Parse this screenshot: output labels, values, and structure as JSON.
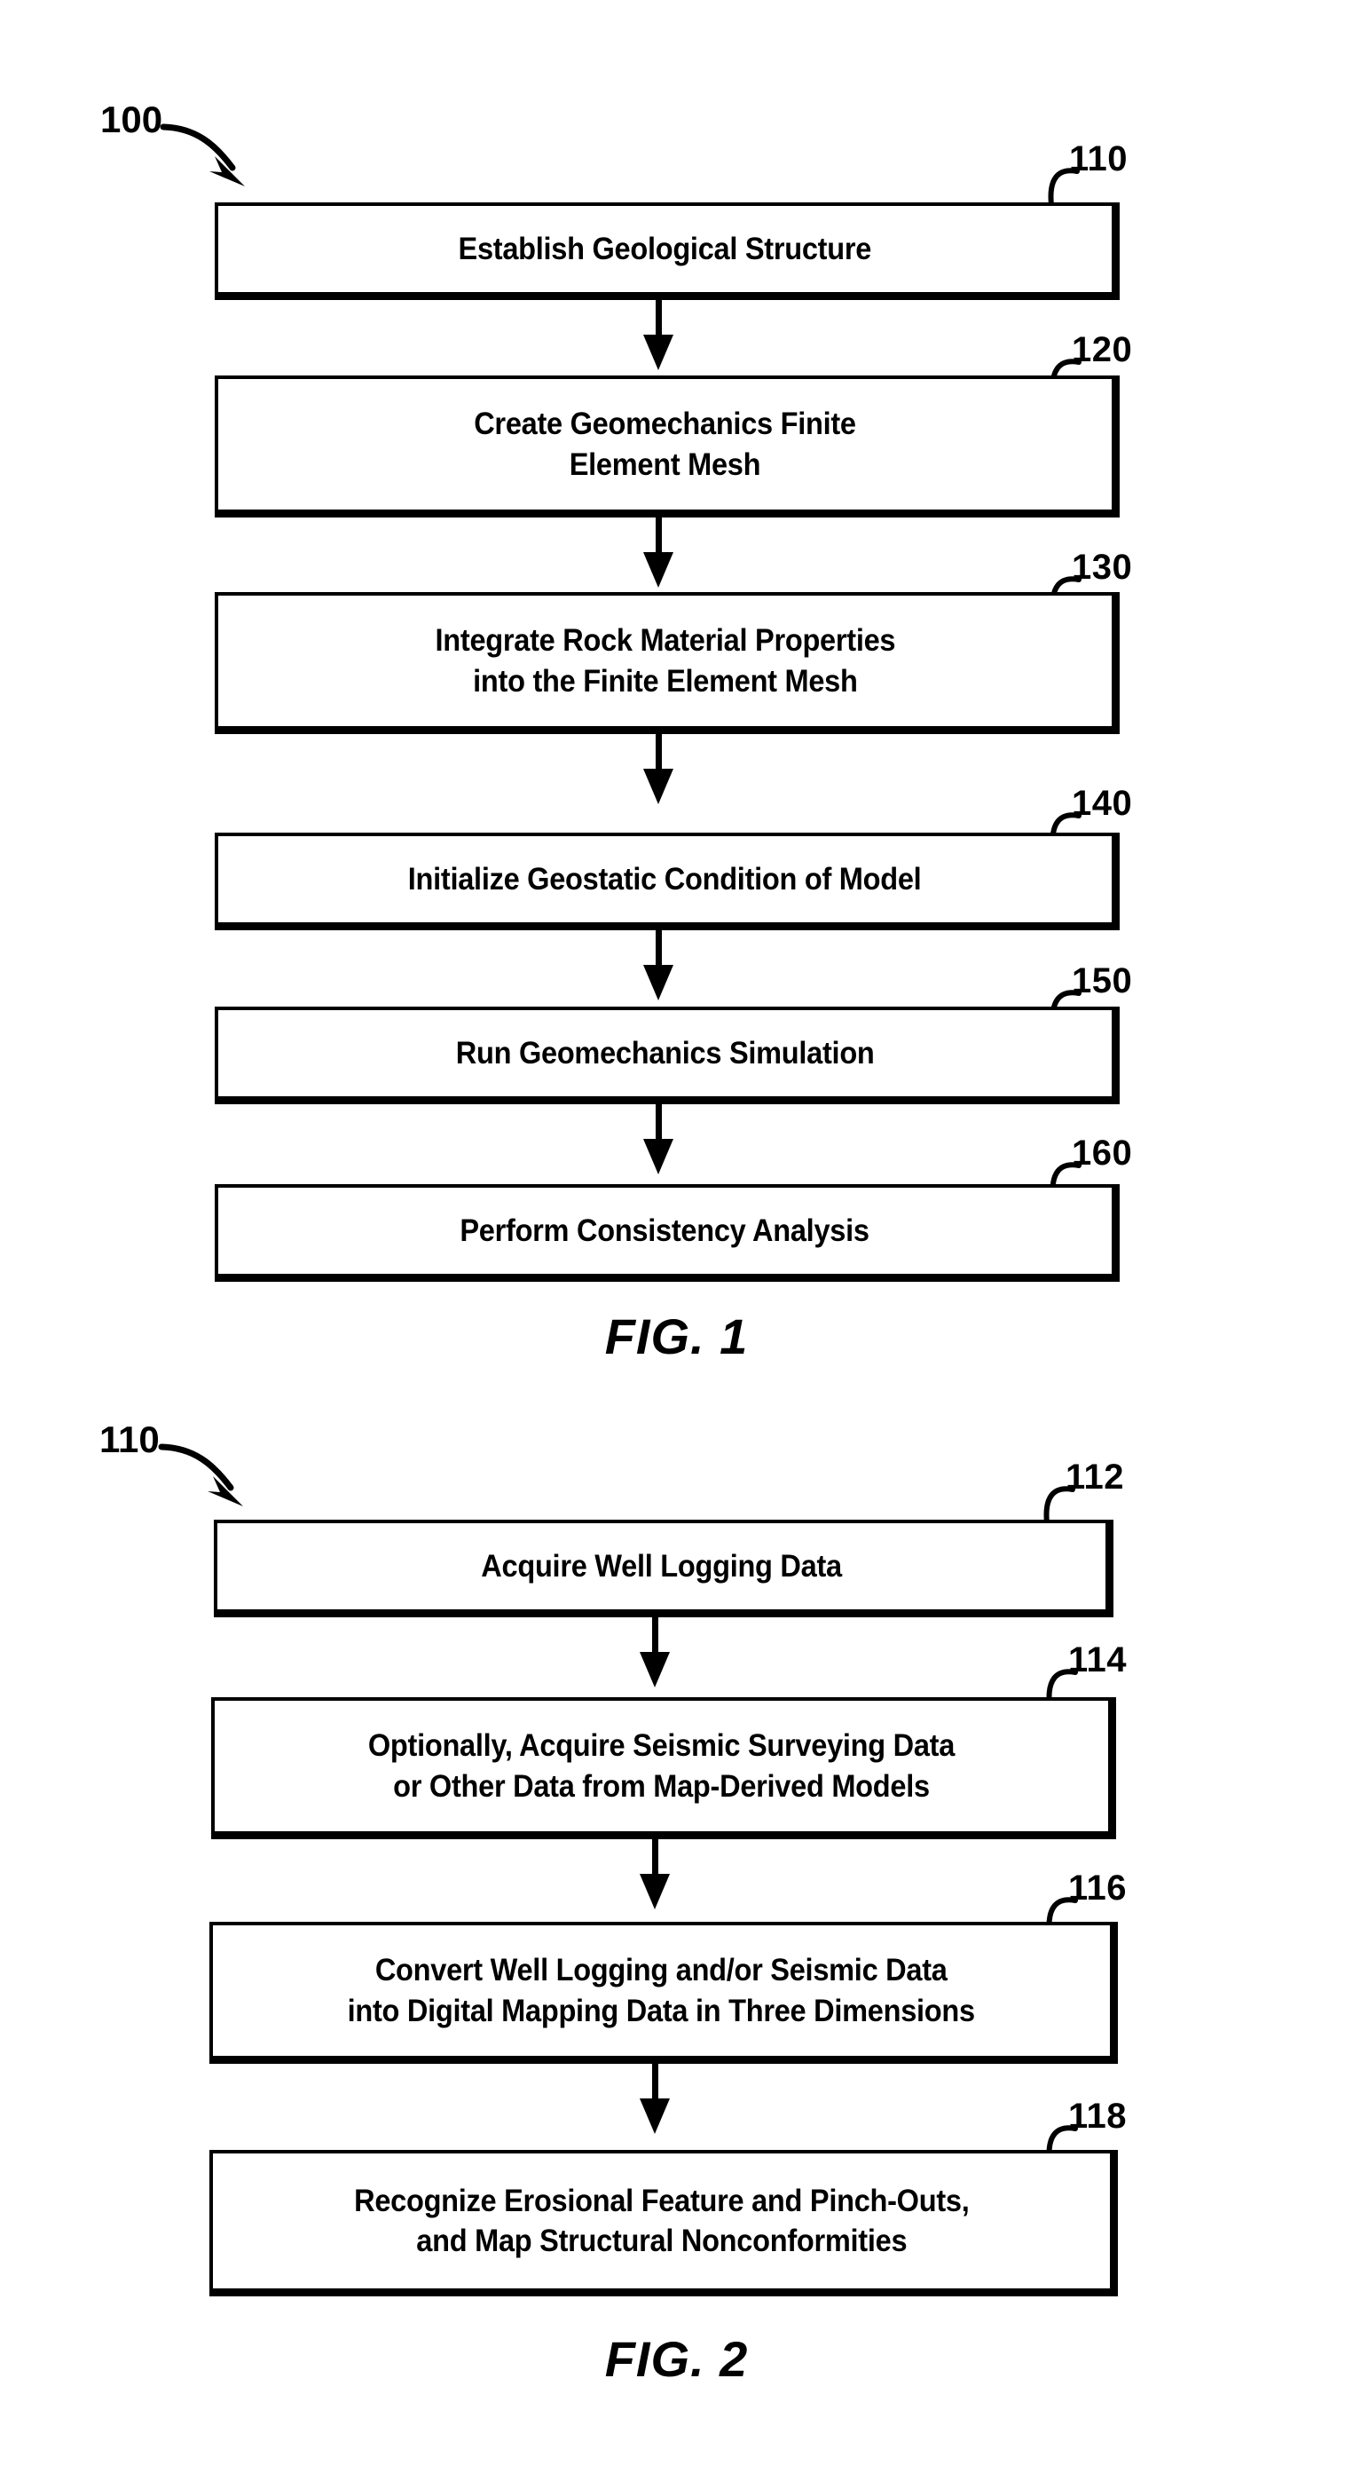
{
  "document": {
    "type": "patent-drawing-sheet",
    "background_color": "#ffffff",
    "ink_color": "#000000"
  },
  "figures": [
    {
      "id": "fig-1",
      "caption": "FIG. 1",
      "diagram_label": "100",
      "steps": [
        {
          "ref": "110",
          "text": "Establish Geological Structure"
        },
        {
          "ref": "120",
          "text": "Create Geomechanics Finite\nElement Mesh"
        },
        {
          "ref": "130",
          "text": "Integrate Rock Material Properties\ninto the Finite Element Mesh"
        },
        {
          "ref": "140",
          "text": "Initialize Geostatic Condition of Model"
        },
        {
          "ref": "150",
          "text": "Run Geomechanics Simulation"
        },
        {
          "ref": "160",
          "text": "Perform Consistency Analysis"
        }
      ]
    },
    {
      "id": "fig-2",
      "caption": "FIG. 2",
      "diagram_label": "110",
      "steps": [
        {
          "ref": "112",
          "text": "Acquire Well Logging Data"
        },
        {
          "ref": "114",
          "text": "Optionally, Acquire Seismic Surveying Data\nor Other Data from Map-Derived Models"
        },
        {
          "ref": "116",
          "text": "Convert Well Logging and/or Seismic Data\ninto Digital Mapping Data in Three Dimensions"
        },
        {
          "ref": "118",
          "text": "Recognize Erosional Feature and Pinch-Outs,\nand Map Structural Nonconformities"
        }
      ]
    }
  ]
}
